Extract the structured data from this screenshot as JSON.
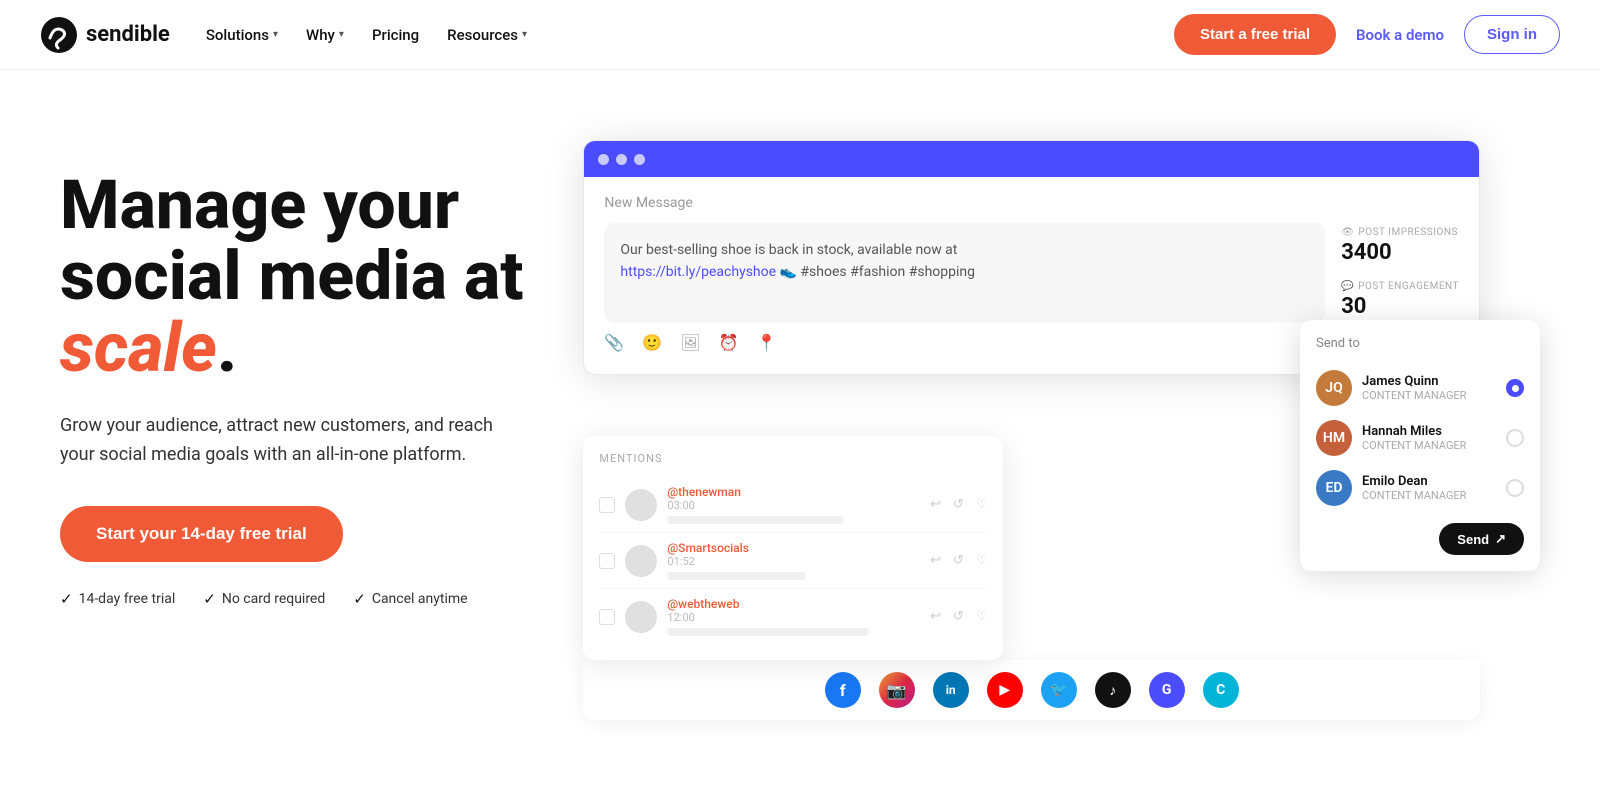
{
  "nav": {
    "logo_text": "sendible",
    "links": [
      {
        "label": "Solutions",
        "has_chevron": true
      },
      {
        "label": "Why",
        "has_chevron": true
      },
      {
        "label": "Pricing",
        "has_chevron": false
      },
      {
        "label": "Resources",
        "has_chevron": true
      }
    ],
    "cta_trial": "Start a free trial",
    "cta_demo": "Book a demo",
    "cta_signin": "Sign in"
  },
  "hero": {
    "heading_line1": "Manage your",
    "heading_line2": "social media at",
    "heading_scale": "scale",
    "heading_period": ".",
    "subtext": "Grow your audience, attract new customers, and reach your social media goals with an all-in-one platform.",
    "cta_button": "Start your 14-day free trial",
    "badges": [
      {
        "icon": "✓",
        "text": "14-day free trial"
      },
      {
        "icon": "✓",
        "text": "No card required"
      },
      {
        "icon": "✓",
        "text": "Cancel anytime"
      }
    ]
  },
  "composer": {
    "window_label": "New Message",
    "message_text": "Our best-selling shoe is back in stock, available now at",
    "message_link": "https://bit.ly/peachyshoe",
    "message_tags": "👟 #shoes #fashion #shopping",
    "stats": [
      {
        "label": "POST IMPRESSIONS",
        "value": "3400"
      },
      {
        "label": "POST ENGAGEMENT",
        "value": "30"
      }
    ]
  },
  "send_to": {
    "label": "Send to",
    "recipients": [
      {
        "name": "James Quinn",
        "role": "CONTENT MANAGER",
        "selected": true,
        "initials": "JQ",
        "avatar_class": "avatar-james"
      },
      {
        "name": "Hannah Miles",
        "role": "CONTENT MANAGER",
        "selected": false,
        "initials": "HM",
        "avatar_class": "avatar-hannah"
      },
      {
        "name": "Emilo Dean",
        "role": "CONTENT MANAGER",
        "selected": false,
        "initials": "ED",
        "avatar_class": "avatar-emilo"
      }
    ],
    "send_button": "Send"
  },
  "mentions": {
    "title": "MENTIONS",
    "items": [
      {
        "name": "@thenewman",
        "time": "03:00",
        "bar_width": "70%"
      },
      {
        "name": "@Smartsocials",
        "time": "01:52",
        "bar_width": "55%"
      },
      {
        "name": "@webtheweb",
        "time": "12:00",
        "bar_width": "80%"
      }
    ]
  },
  "social_icons": [
    {
      "name": "facebook",
      "class": "social-fb",
      "symbol": "f"
    },
    {
      "name": "instagram",
      "class": "social-ig",
      "symbol": "📷"
    },
    {
      "name": "linkedin",
      "class": "social-li",
      "symbol": "in"
    },
    {
      "name": "youtube",
      "class": "social-yt",
      "symbol": "▶"
    },
    {
      "name": "twitter",
      "class": "social-tw",
      "symbol": "🐦"
    },
    {
      "name": "tiktok",
      "class": "social-tk",
      "symbol": "♪"
    },
    {
      "name": "google",
      "class": "social-g",
      "symbol": "G"
    },
    {
      "name": "custom",
      "class": "social-c",
      "symbol": "C"
    }
  ]
}
